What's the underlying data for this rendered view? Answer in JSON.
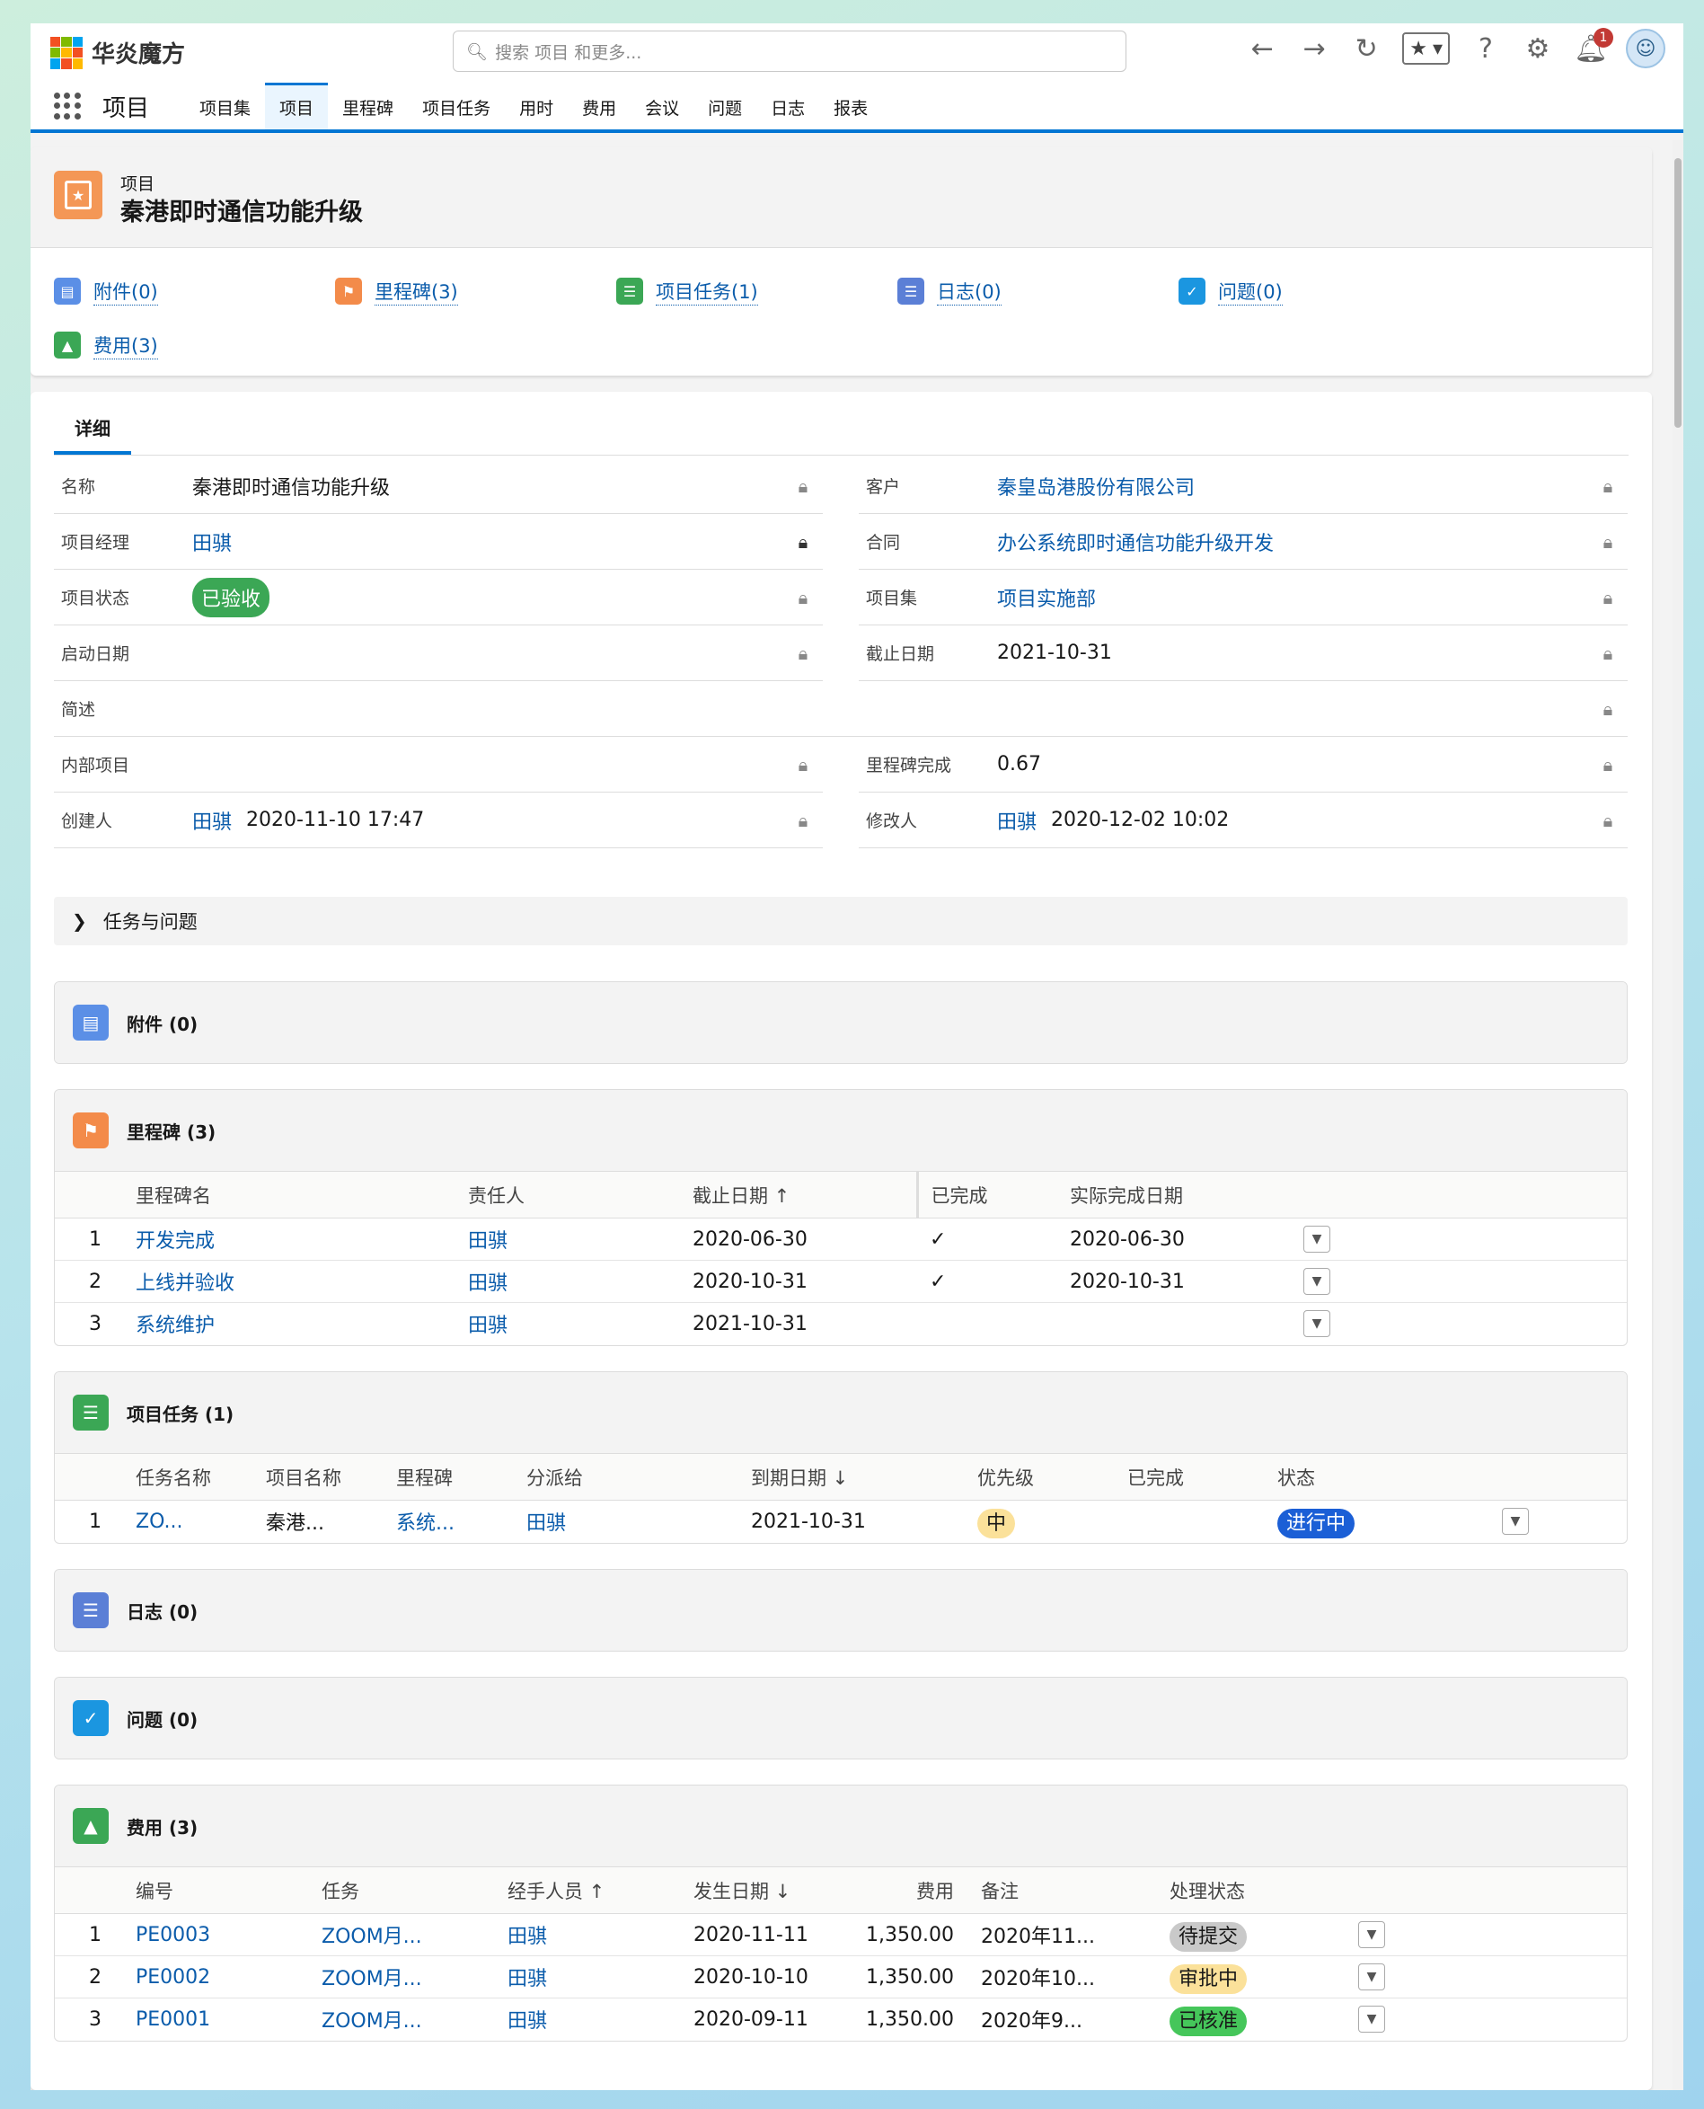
{
  "app": {
    "name": "华炎魔方",
    "section": "项目"
  },
  "search": {
    "placeholder": "搜索 项目 和更多..."
  },
  "header": {
    "notification_count": "1"
  },
  "nav": {
    "tabs": [
      "项目集",
      "项目",
      "里程碑",
      "项目任务",
      "用时",
      "费用",
      "会议",
      "问题",
      "日志",
      "报表"
    ],
    "active": "项目"
  },
  "record": {
    "type": "项目",
    "title": "秦港即时通信功能升级",
    "related_links": [
      "附件(0)",
      "里程碑(3)",
      "项目任务(1)",
      "日志(0)",
      "问题(0)",
      "费用(3)"
    ]
  },
  "detail_tab": "详细",
  "fields": {
    "name": {
      "label": "名称",
      "value": "秦港即时通信功能升级"
    },
    "customer": {
      "label": "客户",
      "value": "秦皇岛港股份有限公司"
    },
    "manager": {
      "label": "项目经理",
      "value": "田骐"
    },
    "contract": {
      "label": "合同",
      "value": "办公系统即时通信功能升级开发"
    },
    "status": {
      "label": "项目状态",
      "value": "已验收"
    },
    "program": {
      "label": "项目集",
      "value": "项目实施部"
    },
    "start_date": {
      "label": "启动日期",
      "value": ""
    },
    "due_date": {
      "label": "截止日期",
      "value": "2021-10-31"
    },
    "description": {
      "label": "简述",
      "value": ""
    },
    "internal": {
      "label": "内部项目",
      "value": ""
    },
    "milestone_completion": {
      "label": "里程碑完成",
      "value": "0.67"
    },
    "created_by": {
      "label": "创建人",
      "user": "田骐",
      "time": "2020-11-10 17:47"
    },
    "modified_by": {
      "label": "修改人",
      "user": "田骐",
      "time": "2020-12-02 10:02"
    }
  },
  "collapsible": {
    "label": "任务与问题"
  },
  "attachments": {
    "title": "附件 (0)"
  },
  "milestones": {
    "title": "里程碑 (3)",
    "columns": [
      "里程碑名",
      "责任人",
      "截止日期 ↑",
      "已完成",
      "实际完成日期"
    ],
    "rows": [
      {
        "n": "1",
        "name": "开发完成",
        "owner": "田骐",
        "due": "2020-06-30",
        "done": "✓",
        "actual": "2020-06-30"
      },
      {
        "n": "2",
        "name": "上线并验收",
        "owner": "田骐",
        "due": "2020-10-31",
        "done": "✓",
        "actual": "2020-10-31"
      },
      {
        "n": "3",
        "name": "系统维护",
        "owner": "田骐",
        "due": "2021-10-31",
        "done": "",
        "actual": ""
      }
    ]
  },
  "tasks": {
    "title": "项目任务 (1)",
    "columns": [
      "任务名称",
      "项目名称",
      "里程碑",
      "分派给",
      "到期日期 ↓",
      "优先级",
      "已完成",
      "状态"
    ],
    "rows": [
      {
        "n": "1",
        "name": "ZO...",
        "project": "秦港...",
        "milestone": "系统...",
        "assignee": "田骐",
        "due": "2021-10-31",
        "priority": "中",
        "done": "",
        "status": "进行中"
      }
    ]
  },
  "logs": {
    "title": "日志 (0)"
  },
  "issues": {
    "title": "问题 (0)"
  },
  "expenses": {
    "title": "费用 (3)",
    "columns": [
      "编号",
      "任务",
      "经手人员 ↑",
      "发生日期 ↓",
      "费用",
      "备注",
      "处理状态"
    ],
    "rows": [
      {
        "n": "1",
        "code": "PE0003",
        "task": "ZOOM月...",
        "handler": "田骐",
        "date": "2020-11-11",
        "amount": "1,350.00",
        "note": "2020年11...",
        "status": "待提交"
      },
      {
        "n": "2",
        "code": "PE0002",
        "task": "ZOOM月...",
        "handler": "田骐",
        "date": "2020-10-10",
        "amount": "1,350.00",
        "note": "2020年10...",
        "status": "审批中"
      },
      {
        "n": "3",
        "code": "PE0001",
        "task": "ZOOM月...",
        "handler": "田骐",
        "date": "2020-09-11",
        "amount": "1,350.00",
        "note": "2020年9...",
        "status": "已核准"
      }
    ]
  },
  "colors": {
    "brand": "#0176d3",
    "link": "#0b5cab",
    "success": "#3ba755"
  }
}
